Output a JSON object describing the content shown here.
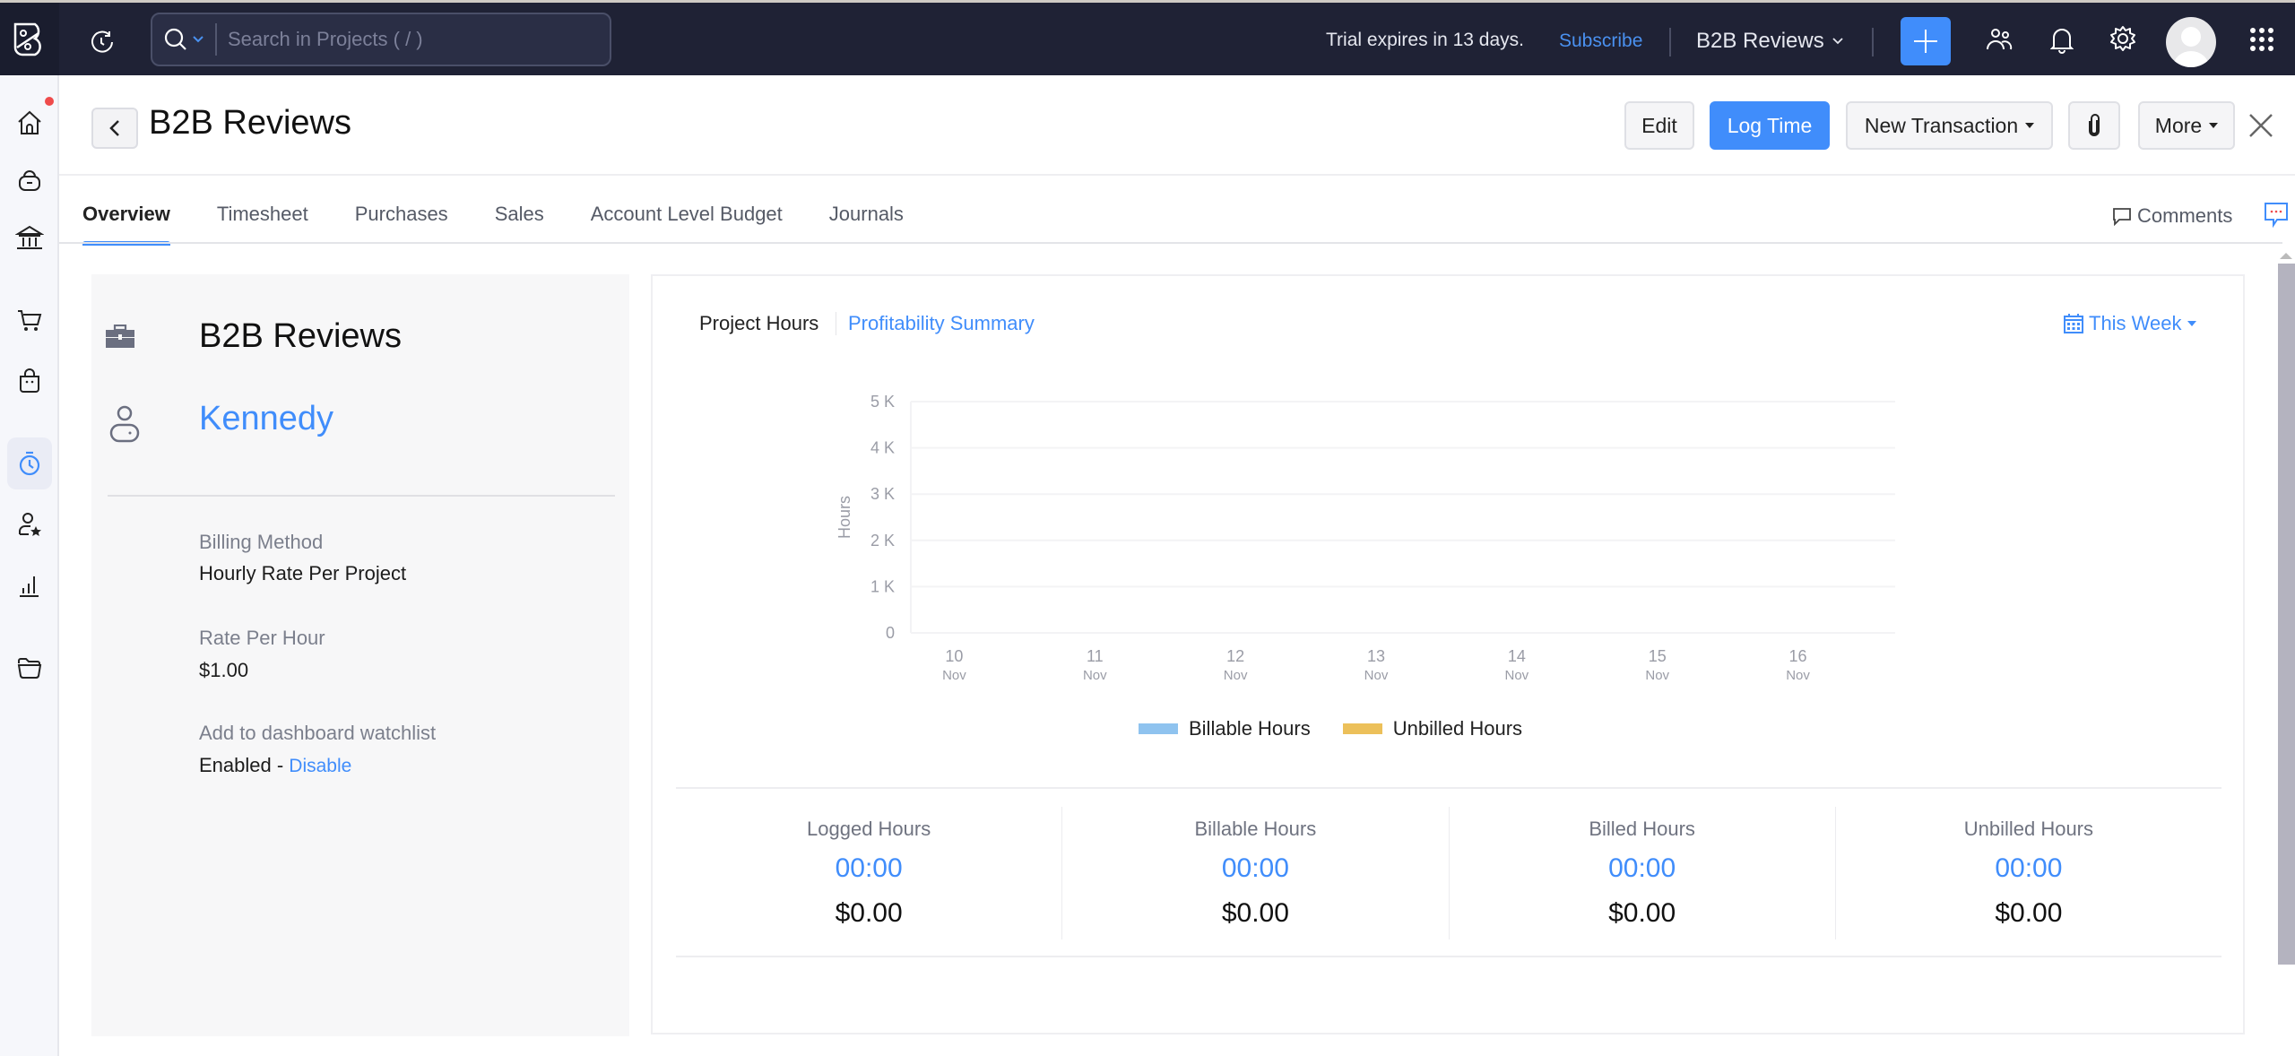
{
  "topbar": {
    "search_placeholder": "Search in Projects ( / )",
    "trial_text": "Trial expires in 13 days.",
    "subscribe_label": "Subscribe",
    "org_name": "B2B Reviews",
    "icons": [
      "app-logo-icon",
      "recent-activity-icon",
      "search-icon",
      "chevron-down-icon",
      "plus-icon",
      "users-icon",
      "bell-icon",
      "gear-icon",
      "avatar",
      "app-grid-icon"
    ]
  },
  "sidebar": {
    "items": [
      {
        "name": "home",
        "icon": "home-icon",
        "has_notification": true
      },
      {
        "name": "items",
        "icon": "basket-icon"
      },
      {
        "name": "banking",
        "icon": "bank-icon"
      },
      {
        "name": "sales",
        "icon": "cart-icon"
      },
      {
        "name": "purchases",
        "icon": "shopping-bag-icon"
      },
      {
        "name": "time-tracking",
        "icon": "stopwatch-icon",
        "active": true
      },
      {
        "name": "accountant",
        "icon": "user-star-icon"
      },
      {
        "name": "reports",
        "icon": "bar-chart-icon"
      },
      {
        "name": "documents",
        "icon": "folder-icon"
      }
    ]
  },
  "header": {
    "title": "B2B Reviews",
    "edit_label": "Edit",
    "log_time_label": "Log Time",
    "new_transaction_label": "New Transaction",
    "more_label": "More"
  },
  "tabs": [
    {
      "label": "Overview",
      "active": true
    },
    {
      "label": "Timesheet"
    },
    {
      "label": "Purchases"
    },
    {
      "label": "Sales"
    },
    {
      "label": "Account Level Budget"
    },
    {
      "label": "Journals"
    }
  ],
  "comments_label": "Comments",
  "project_info": {
    "project_name": "B2B Reviews",
    "customer_name": "Kennedy",
    "fields": [
      {
        "label": "Billing Method",
        "value": "Hourly Rate Per Project"
      },
      {
        "label": "Rate Per Hour",
        "value": "$1.00"
      },
      {
        "label": "Add to dashboard watchlist",
        "value": "Enabled - ",
        "link": "Disable"
      }
    ]
  },
  "hours_panel": {
    "tab_project_hours": "Project Hours",
    "tab_profitability": "Profitability Summary",
    "period_label": "This Week"
  },
  "chart_data": {
    "type": "bar",
    "title": "",
    "xlabel": "",
    "ylabel": "Hours",
    "ylim": [
      0,
      5000
    ],
    "yticks": [
      "0",
      "1 K",
      "2 K",
      "3 K",
      "4 K",
      "5 K"
    ],
    "categories": [
      {
        "day": "10",
        "month": "Nov"
      },
      {
        "day": "11",
        "month": "Nov"
      },
      {
        "day": "12",
        "month": "Nov"
      },
      {
        "day": "13",
        "month": "Nov"
      },
      {
        "day": "14",
        "month": "Nov"
      },
      {
        "day": "15",
        "month": "Nov"
      },
      {
        "day": "16",
        "month": "Nov"
      }
    ],
    "series": [
      {
        "name": "Billable Hours",
        "color": "#8fc3ef",
        "values": [
          0,
          0,
          0,
          0,
          0,
          0,
          0
        ]
      },
      {
        "name": "Unbilled Hours",
        "color": "#ecc05a",
        "values": [
          0,
          0,
          0,
          0,
          0,
          0,
          0
        ]
      }
    ],
    "grid": true,
    "legend": "bottom"
  },
  "stats": [
    {
      "label": "Logged Hours",
      "hours": "00:00",
      "amount": "$0.00"
    },
    {
      "label": "Billable Hours",
      "hours": "00:00",
      "amount": "$0.00"
    },
    {
      "label": "Billed Hours",
      "hours": "00:00",
      "amount": "$0.00"
    },
    {
      "label": "Unbilled Hours",
      "hours": "00:00",
      "amount": "$0.00"
    }
  ],
  "colors": {
    "accent": "#408dfb",
    "topbar_bg": "#1f2235",
    "notification": "#ef4b4b"
  }
}
